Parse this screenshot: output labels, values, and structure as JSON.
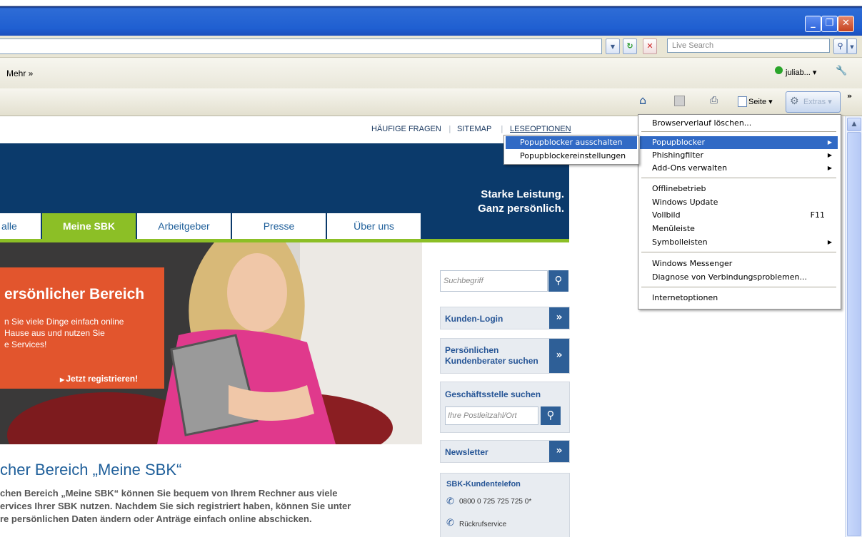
{
  "browser": {
    "search_placeholder": "Live Search",
    "links_more": "Mehr »",
    "user_label": "juliab... ▾",
    "command_bar": {
      "page_label": "Seite ▾",
      "extras_label": "Extras ▾",
      "chevron": "»"
    },
    "window_buttons": {
      "minimize": "_",
      "maximize": "❐",
      "close": "✕"
    }
  },
  "website": {
    "top_links": [
      "HÄUFIGE FRAGEN",
      "SITEMAP",
      "LESEOPTIONEN"
    ],
    "slogan_line1": "Starke Leistung.",
    "slogan_line2": "Ganz persönlich.",
    "nav": [
      {
        "label": "alle",
        "active": false
      },
      {
        "label": "Meine SBK",
        "active": true
      },
      {
        "label": "Arbeitgeber",
        "active": false
      },
      {
        "label": "Presse",
        "active": false
      },
      {
        "label": "Über uns",
        "active": false
      }
    ],
    "hero": {
      "heading": "ersönlicher Bereich",
      "text_line1": "n Sie viele Dinge einfach online",
      "text_line2": "Hause aus und nutzen Sie",
      "text_line3": "e Services!",
      "cta": "Jetzt registrieren!"
    },
    "sidebar": {
      "search_placeholder": "Suchbegriff",
      "kunden_login": "Kunden-Login",
      "berater_line1": "Persönlichen",
      "berater_line2": "Kundenberater suchen",
      "geschaeftsstelle": "Geschäftsstelle suchen",
      "plz_placeholder": "Ihre Postleitzahl/Ort",
      "newsletter": "Newsletter",
      "kundentelefon": "SBK-Kundentelefon",
      "phone": "0800 0 725 725 725 0*",
      "rueckruf": "Rückrufservice"
    },
    "main_heading": "cher Bereich „Meine SBK“",
    "main_text_line1": "chen Bereich „Meine SBK“ können Sie bequem von Ihrem Rechner aus viele",
    "main_text_line2": "ervices Ihrer SBK nutzen. Nachdem Sie sich registriert haben, können Sie unter",
    "main_text_line3": "re persönlichen Daten ändern oder Anträge einfach online abschicken."
  },
  "extras_menu": {
    "items": [
      {
        "label": "Browserverlauf löschen...",
        "submenu": false,
        "shortcut": ""
      },
      {
        "label": "Popupblocker",
        "submenu": true,
        "shortcut": "",
        "selected": true
      },
      {
        "label": "Phishingfilter",
        "submenu": true,
        "shortcut": ""
      },
      {
        "label": "Add-Ons verwalten",
        "submenu": true,
        "shortcut": ""
      },
      {
        "label": "Offlinebetrieb",
        "submenu": false,
        "shortcut": ""
      },
      {
        "label": "Windows Update",
        "submenu": false,
        "shortcut": ""
      },
      {
        "label": "Vollbild",
        "submenu": false,
        "shortcut": "F11"
      },
      {
        "label": "Menüleiste",
        "submenu": false,
        "shortcut": ""
      },
      {
        "label": "Symbolleisten",
        "submenu": true,
        "shortcut": ""
      },
      {
        "label": "Windows Messenger",
        "submenu": false,
        "shortcut": ""
      },
      {
        "label": "Diagnose von Verbindungsproblemen...",
        "submenu": false,
        "shortcut": ""
      },
      {
        "label": "Internetoptionen",
        "submenu": false,
        "shortcut": ""
      }
    ]
  },
  "popup_submenu": {
    "items": [
      {
        "label": "Popupblocker ausschalten",
        "selected": true
      },
      {
        "label": "Popupblockereinstellungen",
        "selected": false
      }
    ]
  },
  "colors": {
    "titlebar": "#1f5fd1",
    "banner": "#0b3a6b",
    "accent_green": "#8cbf26",
    "orange": "#e2552d",
    "menu_highlight": "#316ac5"
  }
}
